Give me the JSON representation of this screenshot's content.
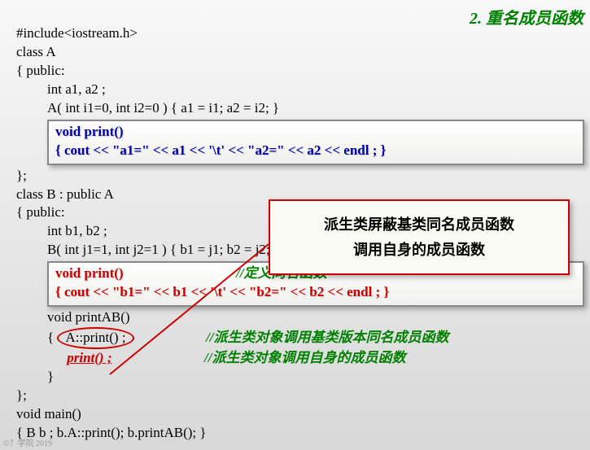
{
  "title": "2. 重名成员函数",
  "code": {
    "l1": "#include<iostream.h>",
    "l2": "class A",
    "l3": "{ public:",
    "l4": "int a1, a2 ;",
    "l5": "A( int i1=0, int i2=0 ) { a1 = i1; a2 = i2; }",
    "boxA_l1": "void print()",
    "boxA_l2": " { cout << \"a1=\" << a1 << '\\t' << \"a2=\" << a2 << endl ; }",
    "l6": "};",
    "l7": "class B : public A",
    "l8": "{ public:",
    "l9": "int b1, b2 ;",
    "l10": "B( int j1=1, int j2=1 ) { b1 = j1; b2 = j2; }",
    "boxB_l1": "void print()",
    "boxB_comment": "//定义同名函数",
    "boxB_l2": " { cout << \"b1=\" << b1 << '\\t' << \"b2=\" << b2 << endl ; }",
    "l11": "void printAB()",
    "l12_pre": " { ",
    "l12_oval": "A::print() ;",
    "l12_comment": "//派生类对象调用基类版本同名成员函数",
    "l13_call": "print() ;",
    "l13_comment": "//派生类对象调用自身的成员函数",
    "l14": "  }",
    "l15": "};",
    "l16": "void main()",
    "l17": "{ B  b ;        b.A::print();        b.printAB();  }"
  },
  "callout": {
    "line1": "派生类屏蔽基类同名成员函数",
    "line2": "调用自身的成员函数"
  },
  "footer": "©？学院 2019"
}
